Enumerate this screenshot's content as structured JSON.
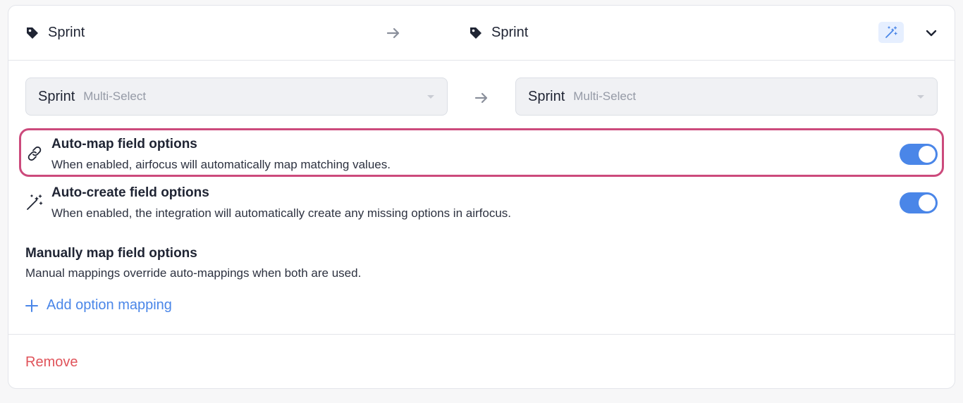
{
  "header": {
    "source_field": "Sprint",
    "target_field": "Sprint",
    "icons": {
      "source": "tag-icon",
      "target": "tag-icon",
      "arrow": "arrow-right-icon",
      "magic": "magic-wand-icon",
      "collapse": "chevron-down-icon"
    }
  },
  "selects": {
    "source": {
      "name": "Sprint",
      "type": "Multi-Select"
    },
    "target": {
      "name": "Sprint",
      "type": "Multi-Select"
    }
  },
  "options": {
    "auto_map": {
      "title": "Auto-map field options",
      "description": "When enabled, airfocus will automatically map matching values.",
      "enabled": true,
      "icon": "link-icon"
    },
    "auto_create": {
      "title": "Auto-create field options",
      "description": "When enabled, the integration will automatically create any missing options in airfocus.",
      "enabled": true,
      "icon": "magic-wand-icon"
    }
  },
  "manual": {
    "title": "Manually map field options",
    "description": "Manual mappings override auto-mappings when both are used.",
    "add_label": "Add option mapping"
  },
  "footer": {
    "remove_label": "Remove"
  },
  "colors": {
    "accent": "#4a86e8",
    "danger": "#e0535a",
    "highlight": "#cc4a7c"
  }
}
